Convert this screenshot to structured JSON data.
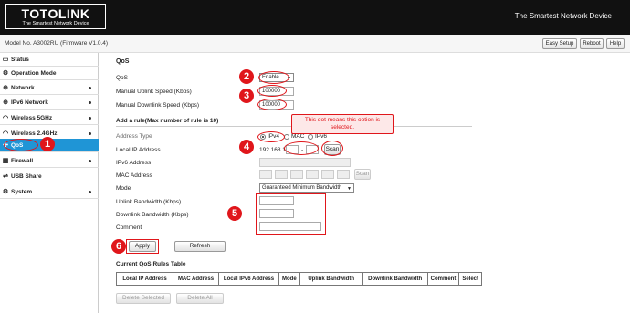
{
  "header": {
    "logo_text": "TOTOLINK",
    "logo_sub": "The Smartest Network Device",
    "tagline": "The Smartest Network Device"
  },
  "model_bar": {
    "model": "Model No. A3002RU (Firmware V1.0.4)",
    "easy_setup": "Easy Setup",
    "reboot": "Reboot",
    "help": "Help"
  },
  "sidebar": {
    "items": [
      {
        "label": "Status",
        "icon": "monitor-icon"
      },
      {
        "label": "Operation Mode",
        "icon": "gear-icon"
      },
      {
        "label": "Network",
        "icon": "globe-icon"
      },
      {
        "label": "IPv6 Network",
        "icon": "globe-icon"
      },
      {
        "label": "Wireless 5GHz",
        "icon": "wifi-icon"
      },
      {
        "label": "Wireless 2.4GHz",
        "icon": "wifi-icon"
      },
      {
        "label": "QoS",
        "icon": "qos-icon"
      },
      {
        "label": "Firewall",
        "icon": "firewall-icon"
      },
      {
        "label": "USB Share",
        "icon": "usb-icon"
      },
      {
        "label": "System",
        "icon": "gear-icon"
      }
    ]
  },
  "qos": {
    "title": "QoS",
    "qos_label": "QoS",
    "qos_value": "Enable",
    "uplink_label": "Manual Uplink Speed (Kbps)",
    "uplink_value": "100000",
    "downlink_label": "Manual Downlink Speed (Kbps)",
    "downlink_value": "100000"
  },
  "rule": {
    "title": "Add a rule(Max number of rule is 10)",
    "address_type_label": "Address Type",
    "ipv4": "IPv4",
    "mac": "MAC",
    "ipv6": "IPv6",
    "local_ip_label": "Local IP Address",
    "ip_prefix": "192.168.1.",
    "ip_dash": "-",
    "scan": "Scan",
    "ipv6_label": "IPv6 Address",
    "mac_label": "MAC Address",
    "scan2": "Scan",
    "mode_label": "Mode",
    "mode_value": "Guaranteed Minimum Bandwidth",
    "uplink_bw_label": "Uplink Bandwidth (Kbps)",
    "downlink_bw_label": "Downlink Bandwidth (Kbps)",
    "comment_label": "Comment",
    "apply": "Apply",
    "refresh": "Refresh"
  },
  "rules_table": {
    "title": "Current QoS Rules Table",
    "headers": [
      "Local IP Address",
      "MAC Address",
      "Local IPv6 Address",
      "Mode",
      "Uplink Bandwidth",
      "Downlink Bandwidth",
      "Comment",
      "Select"
    ],
    "delete_selected": "Delete Selected",
    "delete_all": "Delete All"
  },
  "annotations": {
    "callout": "This dot means this option is selected.",
    "n1": "1",
    "n2": "2",
    "n3": "3",
    "n4": "4",
    "n5": "5",
    "n6": "6",
    "color": "#e0161b"
  }
}
